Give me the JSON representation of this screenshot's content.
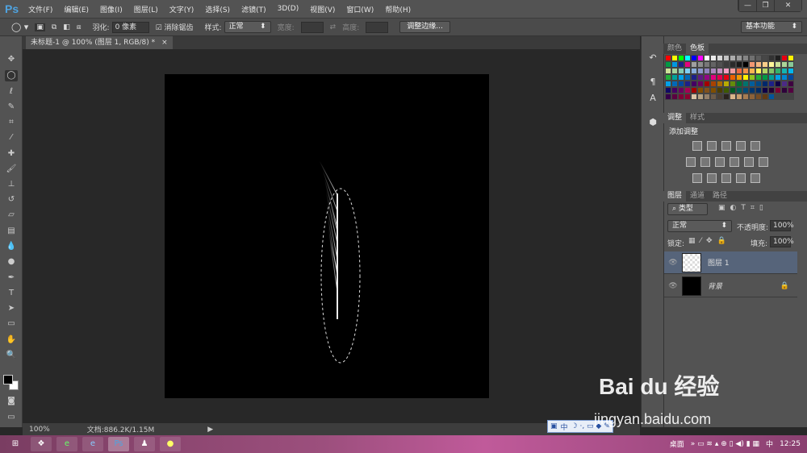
{
  "app": {
    "logo": "Ps"
  },
  "menu": [
    "文件(F)",
    "编辑(E)",
    "图像(I)",
    "图层(L)",
    "文字(Y)",
    "选择(S)",
    "滤镜(T)",
    "3D(D)",
    "视图(V)",
    "窗口(W)",
    "帮助(H)"
  ],
  "window_controls": {
    "minimize": "—",
    "restore": "❐",
    "close": "✕"
  },
  "options": {
    "feather_label": "羽化:",
    "feather_value": "0 像素",
    "antialias_label": "消除锯齿",
    "antialias_checked": true,
    "style_label": "样式:",
    "style_value": "正常",
    "width_label": "宽度:",
    "height_label": "高度:",
    "refine_edge": "调整边缘...",
    "workspace": "基本功能"
  },
  "document": {
    "tab_title": "未标题-1 @ 100% (图层 1, RGB/8) *",
    "close": "×"
  },
  "status": {
    "zoom": "100%",
    "doc_size": "文档:886.2K/1.15M"
  },
  "panels": {
    "color_tabs": [
      "颜色",
      "色板"
    ],
    "swatches": [
      "#ff0000",
      "#ffff00",
      "#00ff00",
      "#00ffff",
      "#0000ff",
      "#ff00ff",
      "#ffffff",
      "#ebebeb",
      "#d6d6d6",
      "#c2c2c2",
      "#adadad",
      "#999999",
      "#858585",
      "#707070",
      "#5c5c5c",
      "#474747",
      "#333333",
      "#1f1f1f",
      "#e60012",
      "#fff100",
      "#009944",
      "#0097e0",
      "#1d2088",
      "#e4007f",
      "#a0a0a0",
      "#8c8c8c",
      "#787878",
      "#646464",
      "#505050",
      "#3c3c3c",
      "#2a2a2a",
      "#181818",
      "#000000",
      "#f19872",
      "#f5b780",
      "#facd89",
      "#fff799",
      "#cce198",
      "#acd598",
      "#89c997",
      "#cce198",
      "#a3d39c",
      "#84cbb4",
      "#7ecef4",
      "#88abda",
      "#8c97cb",
      "#8f82bc",
      "#aa89bd",
      "#c490bf",
      "#f19ec2",
      "#f29c9f",
      "#ec6941",
      "#f19149",
      "#f8b551",
      "#fff45c",
      "#b3d465",
      "#80c269",
      "#32b16c",
      "#13b5b1",
      "#00b7ee",
      "#22ac38",
      "#00a29a",
      "#00a0e9",
      "#0068b7",
      "#1d2088",
      "#601986",
      "#920783",
      "#e4007f",
      "#e5004f",
      "#e60012",
      "#eb6100",
      "#f39800",
      "#fff100",
      "#8fc31f",
      "#22ac38",
      "#009944",
      "#009e96",
      "#00a0e9",
      "#0086d1",
      "#00479d",
      "#00a0e9",
      "#0068b7",
      "#00479d",
      "#1d2088",
      "#440062",
      "#6a005f",
      "#a40000",
      "#a84200",
      "#ac6a00",
      "#b7aa00",
      "#638c0b",
      "#007130",
      "#00736d",
      "#005e9c",
      "#004986",
      "#00286b",
      "#1d2088",
      "#0f0045",
      "#4c2a85",
      "#3e0040",
      "#100964",
      "#440062",
      "#6a005f",
      "#a40054",
      "#a40000",
      "#834e00",
      "#81511c",
      "#7f4e00",
      "#4c3e00",
      "#3d5900",
      "#005a24",
      "#005c57",
      "#004b76",
      "#00356d",
      "#002b64",
      "#0f0045",
      "#220033",
      "#7a0032",
      "#2e003a",
      "#530040",
      "#36004a",
      "#5b0040",
      "#7f0037",
      "#8c0030",
      "#d8c4a6",
      "#b5a283",
      "#948069",
      "#6c5b4a",
      "#4a3f34",
      "#2a231d",
      "#d9b48a",
      "#c69c6d",
      "#a67c52",
      "#8c6239",
      "#754c24",
      "#603913",
      "#00559c",
      "#444444",
      "#444444",
      "#444444"
    ],
    "adjust_tabs": [
      "调整",
      "样式"
    ],
    "adjust_title": "添加调整",
    "layers_tabs": [
      "图层",
      "通道",
      "路径"
    ],
    "filter_kind": "类型",
    "blend_mode": "正常",
    "opacity_label": "不透明度:",
    "opacity": "100%",
    "lock_label": "锁定:",
    "fill_label": "填充:",
    "fill": "100%",
    "layers": [
      {
        "name": "图层 1",
        "selected": true
      },
      {
        "name": "背景",
        "locked": true
      }
    ]
  },
  "ime": {
    "label": "中"
  },
  "taskbar": {
    "desktop": "桌面",
    "lang": "中",
    "time": "12:25"
  },
  "watermark": {
    "brand": "Bai du 经验",
    "url": "jingyan.baidu.com"
  }
}
